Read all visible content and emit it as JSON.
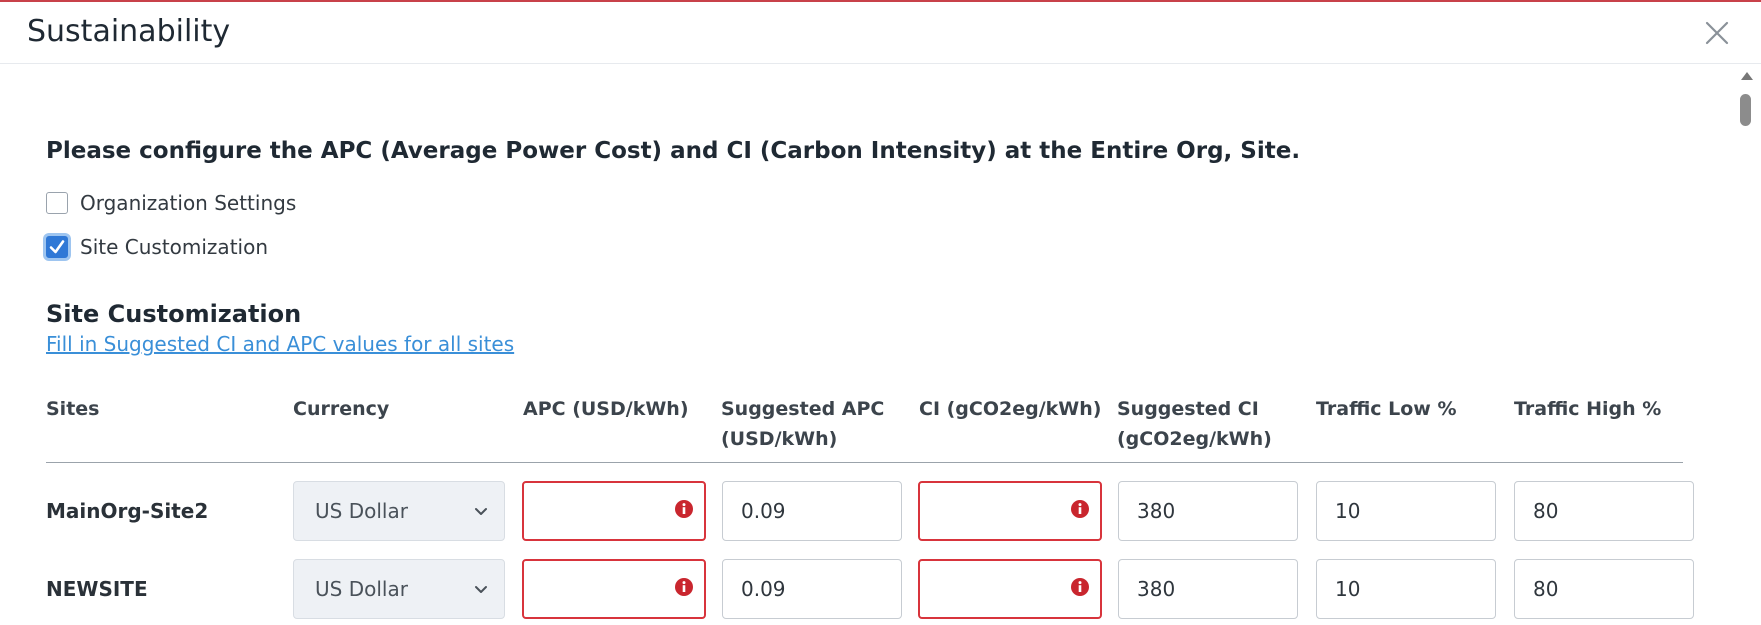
{
  "modal": {
    "title": "Sustainability"
  },
  "intro": "Please configure the APC (Average Power Cost) and CI (Carbon Intensity) at the Entire Org, Site.",
  "options": {
    "org_settings": {
      "label": "Organization Settings",
      "checked": false
    },
    "site_customization": {
      "label": "Site Customization",
      "checked": true
    }
  },
  "section": {
    "title": "Site Customization",
    "fill_link": "Fill in Suggested CI and APC values for all sites"
  },
  "table": {
    "headers": {
      "sites": "Sites",
      "currency": "Currency",
      "apc": "APC (USD/kWh)",
      "suggested_apc_1": "Suggested APC",
      "suggested_apc_2": "(USD/kWh)",
      "ci": "CI (gCO2eg/kWh)",
      "suggested_ci_1": "Suggested CI",
      "suggested_ci_2": "(gCO2eg/kWh)",
      "traffic_low": "Traffic Low %",
      "traffic_high": "Traffic High %"
    },
    "rows": [
      {
        "site": "MainOrg-Site2",
        "currency": "US Dollar",
        "apc": "",
        "suggested_apc": "0.09",
        "ci": "",
        "suggested_ci": "380",
        "traffic_low": "10",
        "traffic_high": "80"
      },
      {
        "site": "NEWSITE",
        "currency": "US Dollar",
        "apc": "",
        "suggested_apc": "0.09",
        "ci": "",
        "suggested_ci": "380",
        "traffic_low": "10",
        "traffic_high": "80"
      }
    ]
  },
  "colors": {
    "accent": "#2f78d6",
    "error": "#d8343c",
    "link": "#3a8fd8",
    "top_border": "#c8414a"
  }
}
